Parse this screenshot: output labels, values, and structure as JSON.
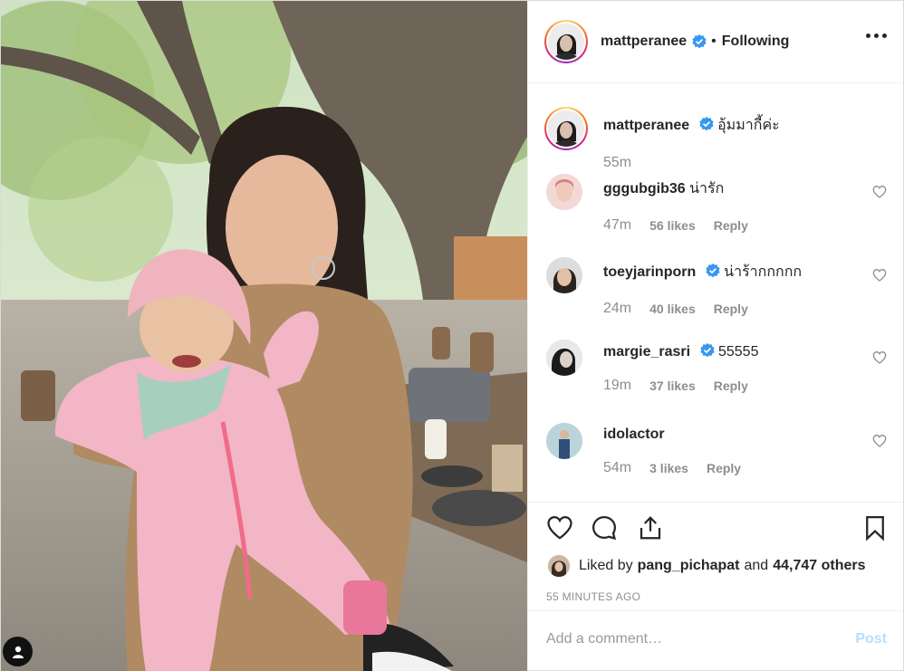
{
  "header": {
    "username": "mattperanee",
    "separator": "•",
    "follow_status": "Following",
    "avatar_icon": "profile-avatar"
  },
  "caption": {
    "username": "mattperanee",
    "text": "อุ้มมากี้ค่ะ",
    "time": "55m"
  },
  "comments": [
    {
      "username": "gggubgib36",
      "verified": false,
      "text": "น่ารัก",
      "time": "47m",
      "likes": "56 likes",
      "reply": "Reply"
    },
    {
      "username": "toeyjarinporn",
      "verified": true,
      "text": "น่าร้ากกกกก",
      "time": "24m",
      "likes": "40 likes",
      "reply": "Reply"
    },
    {
      "username": "margie_rasri",
      "verified": true,
      "text": "55555",
      "time": "19m",
      "likes": "37 likes",
      "reply": "Reply"
    },
    {
      "username": "idolactor",
      "verified": false,
      "text": "",
      "time": "54m",
      "likes": "3 likes",
      "reply": "Reply"
    }
  ],
  "likes": {
    "prefix": "Liked by",
    "user": "pang_pichapat",
    "connector": "and",
    "others": "44,747 others"
  },
  "timestamp": "55 MINUTES AGO",
  "composer": {
    "placeholder": "Add a comment…",
    "post_label": "Post"
  },
  "colors": {
    "verified": "#3897f0",
    "post_button_disabled": "#b2dffc",
    "muted_text": "#8e8e8e"
  }
}
